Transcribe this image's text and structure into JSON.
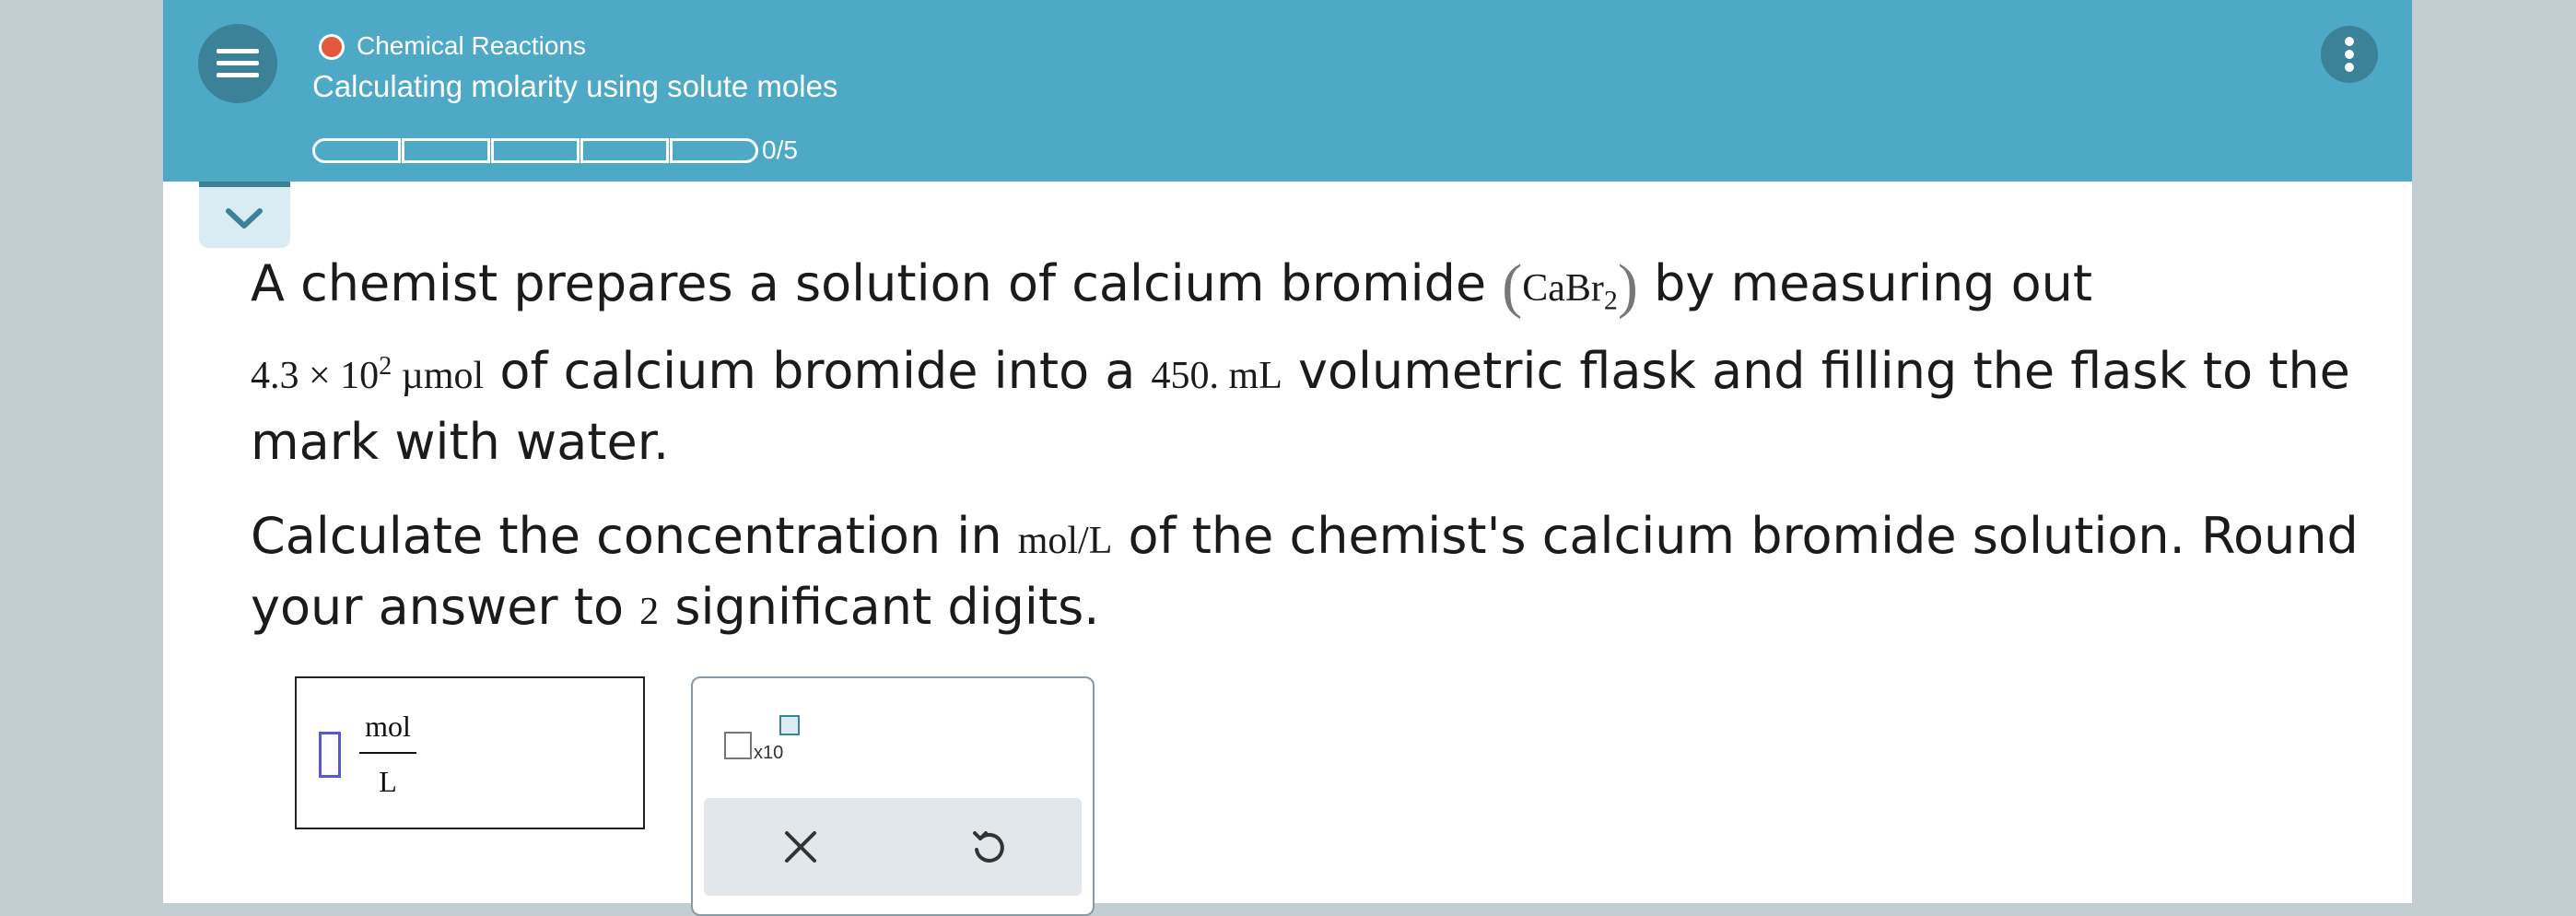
{
  "header": {
    "topic": "Chemical Reactions",
    "title": "Calculating molarity using solute moles",
    "progress_label": "0/5",
    "progress": {
      "completed": 0,
      "total": 5
    },
    "topic_dot_color": "#e4593e",
    "header_color": "#4ea9c7"
  },
  "icons": {
    "menu": "hamburger-menu-icon",
    "more": "vertical-dots-icon",
    "collapse": "chevron-down-icon",
    "clear": "x-icon",
    "undo": "undo-icon"
  },
  "question": {
    "p1_a": "A chemist prepares a solution of calcium bromide ",
    "formula_base": "CaBr",
    "formula_sub": "2",
    "p1_b": " by measuring out",
    "amount_base": "4.3 × 10",
    "amount_exp": "2",
    "amount_unit": "µmol",
    "p1_c": " of calcium bromide into a ",
    "volume": "450. mL",
    "p1_d": " volumetric flask and filling the flask to the mark with water.",
    "p2_a": "Calculate the concentration in ",
    "conc_unit": "mol/L",
    "p2_b": " of the chemist's calcium bromide solution. Round your answer to ",
    "sig_digits": "2",
    "p2_c": " significant digits."
  },
  "answer": {
    "value": "",
    "unit_numerator": "mol",
    "unit_denominator": "L"
  },
  "tools": {
    "sci_label": "x10"
  }
}
